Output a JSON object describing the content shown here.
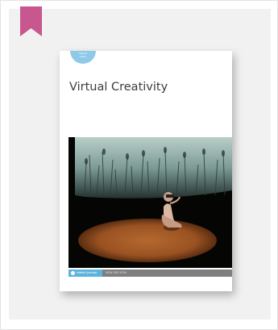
{
  "journal": {
    "title": "Virtual Creativity",
    "badge_line1": "Volume",
    "badge_line2": "Issue",
    "publisher": "intellect journals",
    "issn": "ISSN 2397-9704"
  },
  "colors": {
    "bookmark": "#c8568f",
    "badge": "#8fc9e8",
    "footer_accent": "#5cb3dc",
    "footer_bar": "#7f7f7f"
  },
  "icons": {
    "bookmark": "bookmark-icon",
    "publisher_logo": "intellect-logo-icon"
  }
}
